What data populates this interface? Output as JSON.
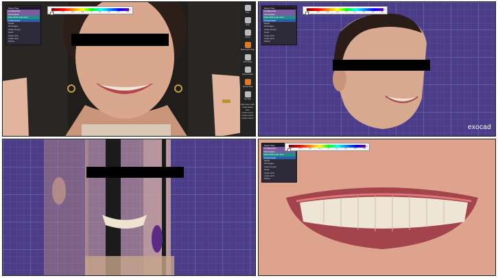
{
  "app": {
    "watermark": "exocad"
  },
  "scale_bar": {
    "ticks": [
      "-0.4",
      "-0.3",
      "-0.2",
      "-0.1",
      "0",
      "0.1",
      "0.2",
      "0.3",
      "0.4"
    ],
    "checkbox_label": "Show colormap"
  },
  "tree_panel": {
    "items": [
      {
        "label": "Scene Tree",
        "style": "hdr"
      },
      {
        "label": "Configuration",
        "style": "sel"
      },
      {
        "label": "3D Analysis",
        "style": "sel"
      },
      {
        "label": "Face Scan (Lab cam)",
        "style": "teal"
      },
      {
        "label": "SmileCreator",
        "style": "blue"
      },
      {
        "label": "Model",
        "style": ""
      },
      {
        "label": "2D Images",
        "style": ""
      },
      {
        "label": "Smile Curves",
        "style": ""
      },
      {
        "label": "Teeth",
        "style": ""
      },
      {
        "label": "Upper arch",
        "style": ""
      },
      {
        "label": "Lower arch",
        "style": ""
      },
      {
        "label": "Others",
        "style": ""
      }
    ]
  },
  "toolbar": {
    "buttons": [
      {
        "label": "Free",
        "icon": "hand-icon",
        "color": "#bbbbbb"
      },
      {
        "label": "Tools",
        "icon": "wrench-icon",
        "color": "#bbbbbb"
      },
      {
        "label": "Wizard",
        "icon": "wand-icon",
        "color": "#bbbbbb"
      },
      {
        "label": "Show expert mode",
        "icon": "tooth-icon",
        "color": "#e07a1f"
      },
      {
        "label": "Tooth library",
        "icon": "library-icon",
        "color": "#bbbbbb"
      },
      {
        "label": "Output Position",
        "icon": "position-icon",
        "color": "#bbbbbb"
      },
      {
        "label": "Preview Face",
        "icon": "face-icon",
        "color": "#e07a1f"
      },
      {
        "label": "Text Help",
        "icon": "help-icon",
        "color": "#bbbbbb"
      }
    ],
    "text_items": [
      "Edit custom view",
      "Smile Design Rest",
      "Custom view 1",
      "Custom view 2",
      "Custom view 3"
    ]
  },
  "colors": {
    "grid_bg": "#4b3d8a",
    "accent": "#e07a1f"
  }
}
